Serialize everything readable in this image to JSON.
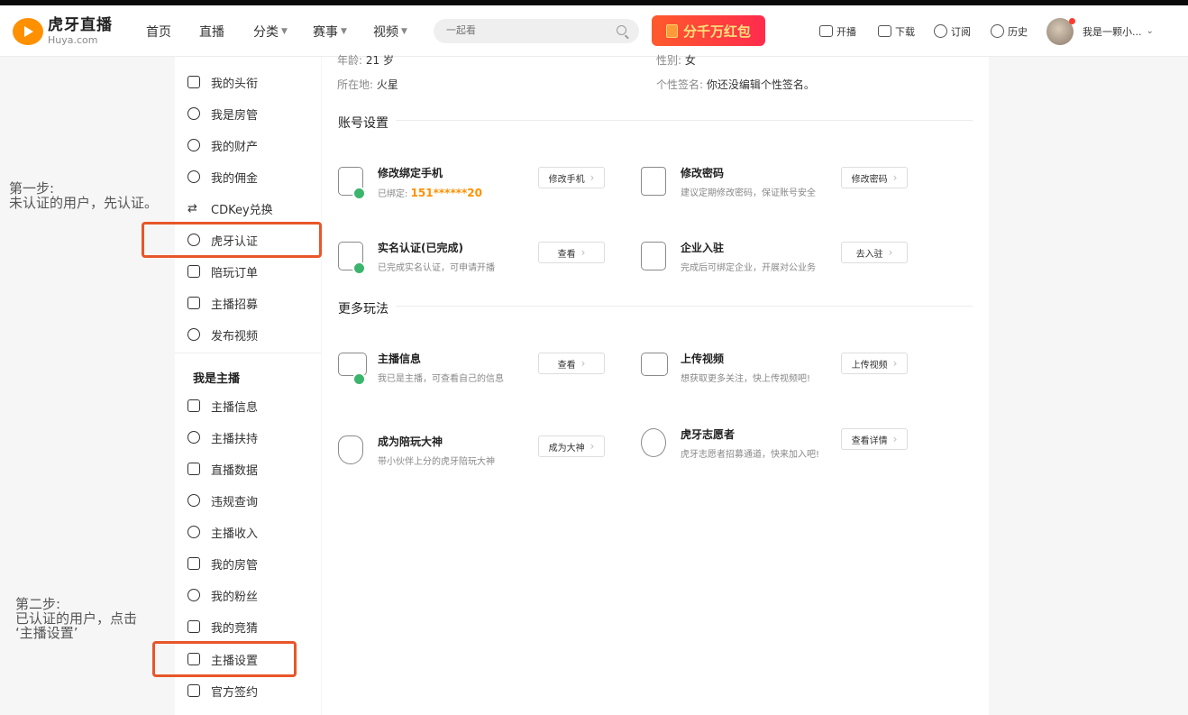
{
  "header": {
    "logo_cn": "虎牙直播",
    "logo_en": "Huya.com",
    "nav": [
      {
        "label": "首页",
        "caret": false
      },
      {
        "label": "直播",
        "caret": false
      },
      {
        "label": "分类",
        "caret": true
      },
      {
        "label": "赛事",
        "caret": true
      },
      {
        "label": "视频",
        "caret": true
      }
    ],
    "search_placeholder": "一起看",
    "red_packet": "分千万红包",
    "actions": [
      "开播",
      "下载",
      "订阅",
      "历史"
    ],
    "username": "我是一颗小..."
  },
  "sidebar": {
    "items": [
      "我的头衔",
      "我是房管",
      "我的财产",
      "我的佣金",
      "CDKey兑换",
      "虎牙认证",
      "陪玩订单",
      "主播招募",
      "发布视频"
    ],
    "group_title": "我是主播",
    "anchor_items": [
      "主播信息",
      "主播扶持",
      "直播数据",
      "违规查询",
      "主播收入",
      "我的房管",
      "我的粉丝",
      "我的竞猜",
      "主播设置",
      "官方签约"
    ]
  },
  "profile": {
    "age_label": "年龄:",
    "age_value": "21 岁",
    "gender_label": "性别:",
    "gender_value": "女",
    "location_label": "所在地:",
    "location_value": "火星",
    "signature_label": "个性签名:",
    "signature_value": "你还没编辑个性签名。"
  },
  "account": {
    "title": "账号设置",
    "cards": [
      {
        "title": "修改绑定手机",
        "desc_prefix": "已绑定: ",
        "desc_value": "151******20",
        "button": "修改手机"
      },
      {
        "title": "修改密码",
        "desc": "建议定期修改密码，保证账号安全",
        "button": "修改密码"
      },
      {
        "title": "实名认证(已完成)",
        "desc": "已完成实名认证，可申请开播",
        "button": "查看"
      },
      {
        "title": "企业入驻",
        "desc": "完成后可绑定企业，开展对公业务",
        "button": "去入驻"
      }
    ]
  },
  "more": {
    "title": "更多玩法",
    "cards": [
      {
        "title": "主播信息",
        "desc": "我已是主播，可查看自己的信息",
        "button": "查看"
      },
      {
        "title": "上传视频",
        "desc": "想获取更多关注，快上传视频吧!",
        "button": "上传视频"
      },
      {
        "title": "成为陪玩大神",
        "desc": "带小伙伴上分的虎牙陪玩大神",
        "button": "成为大神"
      },
      {
        "title": "虎牙志愿者",
        "desc": "虎牙志愿者招募通道，快来加入吧!",
        "button": "查看详情"
      }
    ]
  },
  "annotations": {
    "step1_title": "第一步:",
    "step1_text": "未认证的用户，先认证。",
    "step2_title": "第二步:",
    "step2_line1": "已认证的用户，点击",
    "step2_line2": "‘主播设置’"
  },
  "colors": {
    "accent": "#ff9000",
    "highlight": "#e8562a",
    "verified": "#3bb56c"
  }
}
